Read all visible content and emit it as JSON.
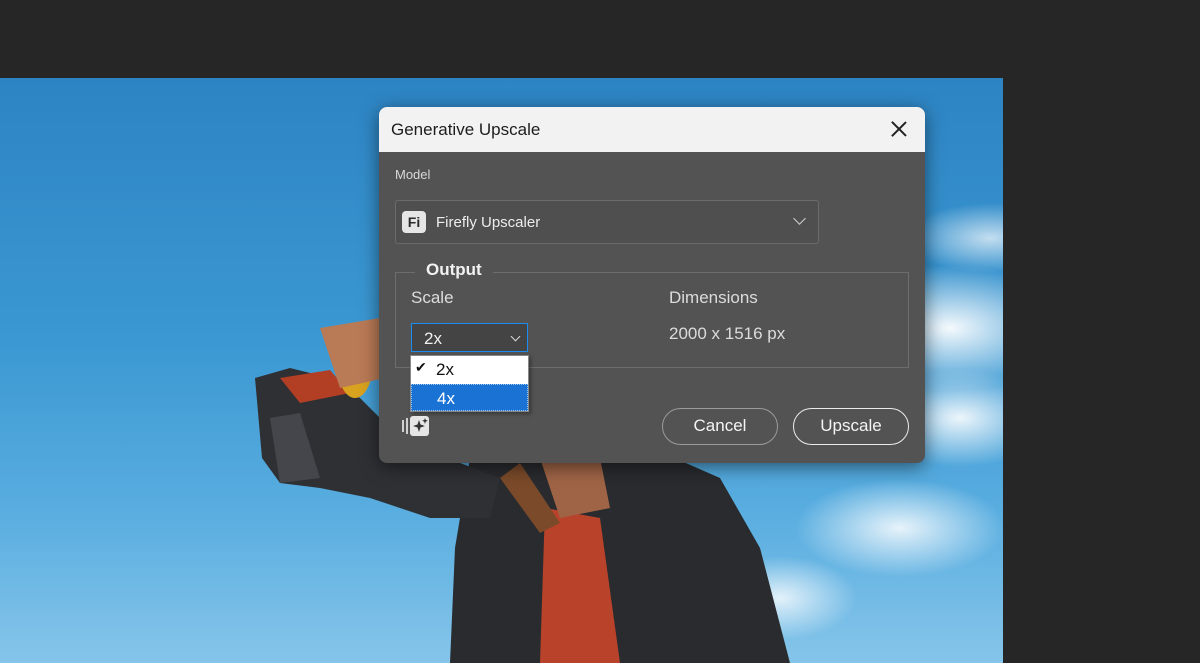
{
  "dialog": {
    "title": "Generative Upscale",
    "model_label": "Model",
    "model": {
      "icon_text": "Fi",
      "selected": "Firefly Upscaler"
    },
    "output": {
      "legend": "Output",
      "scale_label": "Scale",
      "scale_value": "2x",
      "scale_options": [
        "2x",
        "4x"
      ],
      "dimensions_label": "Dimensions",
      "dimensions_value": "2000 x 1516 px"
    },
    "buttons": {
      "cancel": "Cancel",
      "upscale": "Upscale"
    }
  },
  "icons": {
    "close": "close-icon",
    "model_chevron": "chevron-down-icon",
    "scale_chevron": "chevron-down-icon",
    "check": "checkmark-icon",
    "sparkle": "generative-sparkle-icon",
    "firefly": "firefly-logo-icon"
  },
  "colors": {
    "dialog_bg": "#535353",
    "titlebar_bg": "#f2f2f2",
    "workspace_bg": "#262626",
    "selection_blue": "#1a72d4"
  }
}
